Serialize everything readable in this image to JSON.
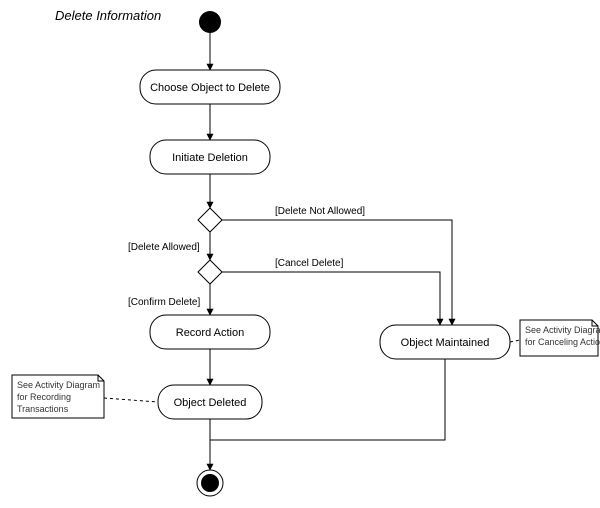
{
  "title": "Delete Information",
  "nodes": {
    "choose": "Choose Object to Delete",
    "initiate": "Initiate Deletion",
    "record": "Record Action",
    "deleted": "Object Deleted",
    "maintained": "Object Maintained"
  },
  "guards": {
    "delete_not_allowed": "[Delete Not Allowed]",
    "delete_allowed": "[Delete Allowed]",
    "cancel_delete": "[Cancel Delete]",
    "confirm_delete": "[Confirm Delete]"
  },
  "notes": {
    "record_note_l1": "See Activity Diagram",
    "record_note_l2": "for Recording",
    "record_note_l3": "Transactions",
    "maint_note_l1": "See Activity Diagram",
    "maint_note_l2": "for Canceling Actions"
  }
}
